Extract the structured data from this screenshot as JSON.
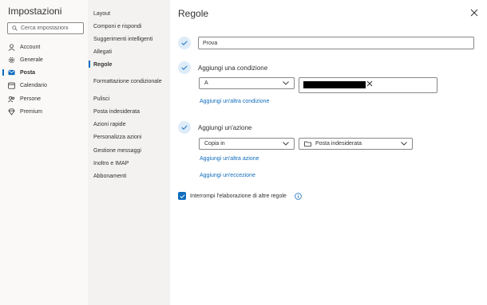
{
  "app": {
    "title": "Impostazioni"
  },
  "search": {
    "placeholder": "Cerca impostazioni"
  },
  "nav": {
    "items": [
      {
        "label": "Account",
        "icon": "user-icon"
      },
      {
        "label": "Generale",
        "icon": "gear-icon"
      },
      {
        "label": "Posta",
        "icon": "mail-icon",
        "active": true
      },
      {
        "label": "Calendario",
        "icon": "calendar-icon"
      },
      {
        "label": "Persone",
        "icon": "people-icon"
      },
      {
        "label": "Premium",
        "icon": "diamond-icon"
      }
    ]
  },
  "submenu": {
    "items": [
      "Layout",
      "Componi e rispondi",
      "Suggerimenti intelligenti",
      "Allegati",
      "Regole",
      "Formattazione condizionale",
      "Pulisci",
      "Posta indesiderata",
      "Azioni rapide",
      "Personalizza azioni",
      "Gestione messaggi",
      "Inoltro e IMAP",
      "Abbonamenti"
    ],
    "active": "Regole"
  },
  "panel": {
    "title": "Regole",
    "rule_name": "Prova",
    "condition": {
      "label": "Aggiungi una condizione",
      "dropdown_value": "A",
      "add_link": "Aggiungi un'altra condizione"
    },
    "action": {
      "label": "Aggiungi un'azione",
      "dropdown_value": "Copia in",
      "folder_value": "Posta indesiderata",
      "add_link": "Aggiungi un'altra azione"
    },
    "exception_link": "Aggiungi un'eccezione",
    "stop_processing": {
      "label": "Interrompi l'elaborazione di altre regole",
      "checked": true
    }
  },
  "colors": {
    "accent": "#0f6cbd",
    "check_bg": "#deecf9",
    "left_bg": "#faf9f8",
    "mid_bg": "#f3f2f1"
  }
}
